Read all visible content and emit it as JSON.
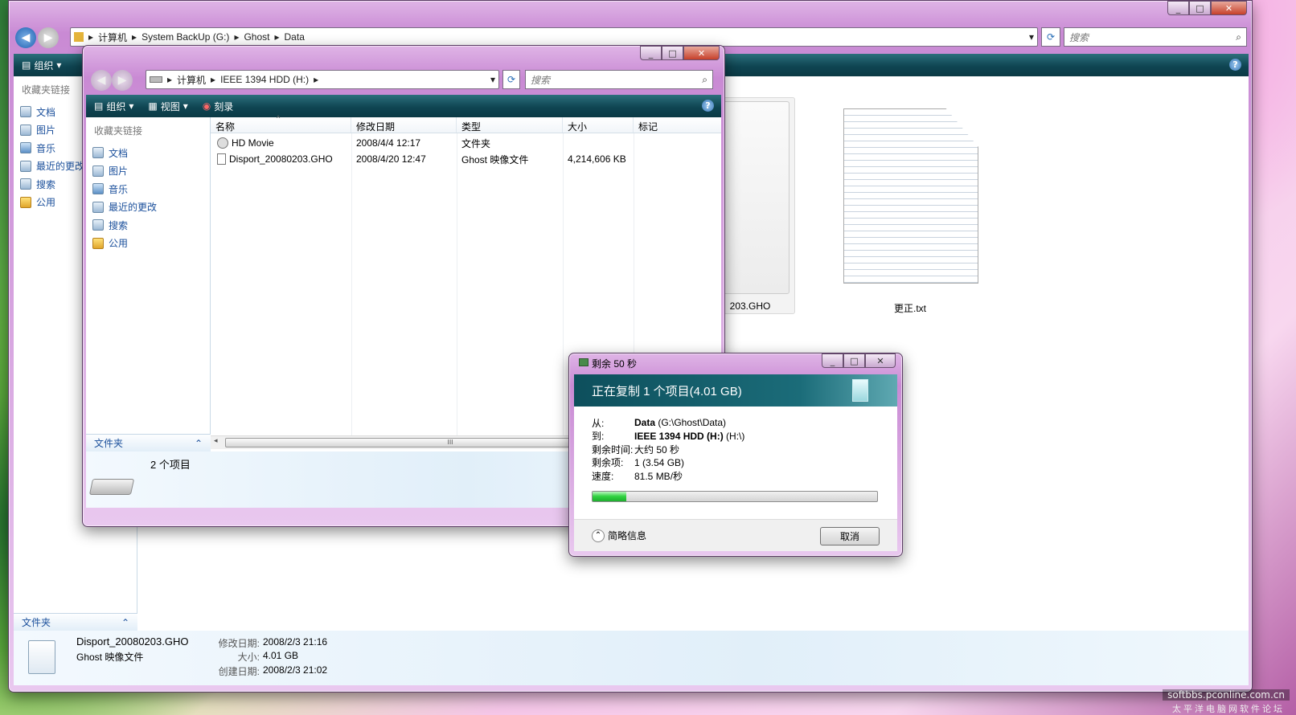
{
  "back_window": {
    "breadcrumb": [
      "计算机",
      "System BackUp (G:)",
      "Ghost",
      "Data"
    ],
    "search_placeholder": "搜索",
    "toolbar": {
      "organize": "组织"
    },
    "favorites_header": "收藏夹链接",
    "nav_items": [
      "文档",
      "图片",
      "音乐",
      "最近的更改",
      "搜索",
      "公用"
    ],
    "folders_label": "文件夹",
    "icons": [
      {
        "label": "203.GHO"
      },
      {
        "label": "更正.txt"
      }
    ],
    "details": {
      "name": "Disport_20080203.GHO",
      "type": "Ghost 映像文件",
      "modified_label": "修改日期:",
      "modified": "2008/2/3 21:16",
      "size_label": "大小:",
      "size": "4.01 GB",
      "created_label": "创建日期:",
      "created": "2008/2/3 21:02"
    }
  },
  "front_window": {
    "breadcrumb": [
      "计算机",
      "IEEE 1394 HDD (H:)"
    ],
    "search_placeholder": "搜索",
    "toolbar": {
      "organize": "组织",
      "views": "视图",
      "burn": "刻录"
    },
    "favorites_header": "收藏夹链接",
    "nav_items": [
      "文档",
      "图片",
      "音乐",
      "最近的更改",
      "搜索",
      "公用"
    ],
    "folders_label": "文件夹",
    "columns": [
      "名称",
      "修改日期",
      "类型",
      "大小",
      "标记"
    ],
    "files": [
      {
        "name": "HD Movie",
        "date": "2008/4/4 12:17",
        "type": "文件夹",
        "size": ""
      },
      {
        "name": "Disport_20080203.GHO",
        "date": "2008/4/20 12:47",
        "type": "Ghost 映像文件",
        "size": "4,214,606 KB"
      }
    ],
    "scroll_grip": "III",
    "item_count": "2 个项目"
  },
  "copy_dialog": {
    "title": "剩余 50 秒",
    "heading": "正在复制 1 个项目(4.01 GB)",
    "from_label": "从:",
    "from_bold": "Data",
    "from_path": " (G:\\Ghost\\Data)",
    "to_label": "到:",
    "to_bold": "IEEE 1394 HDD (H:)",
    "to_path": " (H:\\)",
    "time_label": "剩余时间:",
    "time": "大约 50 秒",
    "items_label": "剩余项:",
    "items": "1 (3.54 GB)",
    "speed_label": "速度:",
    "speed": "81.5 MB/秒",
    "progress": 0.12,
    "less_info": "简略信息",
    "cancel": "取消"
  },
  "watermark": {
    "line1": "softbbs.pconline.com.cn",
    "line2": "太平洋电脑网软件论坛"
  },
  "colors": {
    "toolbar": "#0f4552",
    "progress": "#2fd13f",
    "link": "#1a4f9b"
  }
}
